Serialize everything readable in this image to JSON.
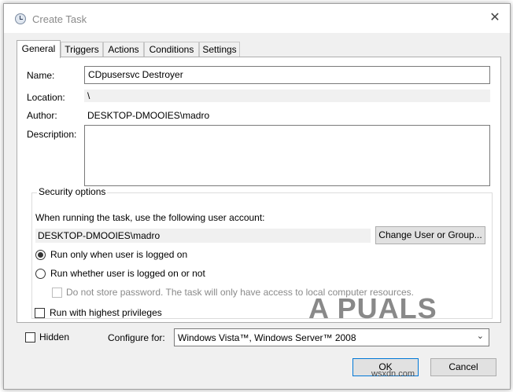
{
  "window": {
    "title": "Create Task",
    "close_glyph": "✕",
    "title_icon": "clock-icon"
  },
  "tabs": [
    {
      "label": "General",
      "active": true
    },
    {
      "label": "Triggers",
      "active": false
    },
    {
      "label": "Actions",
      "active": false
    },
    {
      "label": "Conditions",
      "active": false
    },
    {
      "label": "Settings",
      "active": false
    }
  ],
  "general": {
    "name_label": "Name:",
    "name_value": "CDpusersvc Destroyer",
    "location_label": "Location:",
    "location_value": "\\",
    "author_label": "Author:",
    "author_value": "DESKTOP-DMOOIES\\madro",
    "description_label": "Description:",
    "description_value": ""
  },
  "security": {
    "title": "Security options",
    "account_prompt": "When running the task, use the following user account:",
    "account_value": "DESKTOP-DMOOIES\\madro",
    "change_button": "Change User or Group...",
    "radio_logged_on": "Run only when user is logged on",
    "radio_logged_on_selected": true,
    "radio_whether": "Run whether user is logged on or not",
    "radio_whether_selected": false,
    "no_store_password": "Do not store password.  The task will only have access to local computer resources.",
    "highest_privileges": "Run with highest privileges"
  },
  "footer": {
    "hidden_label": "Hidden",
    "configure_label": "Configure for:",
    "configure_value": "Windows Vista™, Windows Server™ 2008",
    "ok_button": "OK",
    "cancel_button": "Cancel"
  },
  "watermark": {
    "text": "A  PUALS",
    "site": "wsxdn.com"
  },
  "colors": {
    "accent": "#0078d7",
    "window_bg": "#f0f0f0",
    "panel_bg": "#ffffff"
  }
}
